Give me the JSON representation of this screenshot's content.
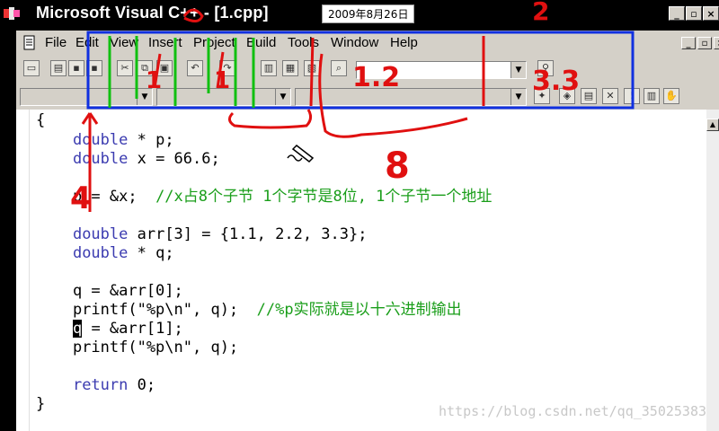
{
  "window": {
    "title": "Microsoft Visual C++ - [1.cpp]",
    "date_stamp": "2009年8月26日",
    "controls": [
      "_",
      "ꟷ",
      "×"
    ]
  },
  "menubar": {
    "items": [
      "File",
      "Edit",
      "View",
      "Insert",
      "Project",
      "Build",
      "Tools",
      "Window",
      "Help"
    ]
  },
  "toolbar": {
    "icons": [
      "new-file-icon",
      "open-folder-icon",
      "save-icon",
      "save-all-icon",
      "cut-icon",
      "copy-icon",
      "paste-icon",
      "undo-icon",
      "redo-icon",
      "workspace-icon",
      "output-icon",
      "window-list-icon",
      "find-in-files-icon"
    ],
    "find_combo_value": "",
    "wizard_icons": [
      "class-wizard-icon",
      "compile-icon",
      "build-icon",
      "stop-build-icon",
      "go-icon",
      "insert-breakpoint-icon",
      "hand-icon"
    ]
  },
  "code": {
    "lines": [
      "{",
      "    double * p;",
      "    double x = 66.6;",
      "",
      "    p = &x;  //x占8个子节 1个字节是8位, 1个子节一个地址",
      "",
      "    double arr[3] = {1.1, 2.2, 3.3};",
      "    double * q;",
      "",
      "    q = &arr[0];",
      "    printf(\"%p\\n\", q);  //%p实际就是以十六进制输出",
      "    q = &arr[1];",
      "    printf(\"%p\\n\", q);",
      "",
      "    return 0;",
      "}"
    ]
  },
  "annotations": {
    "labels": [
      "2",
      "1",
      "1",
      "1",
      "1.2",
      "3.3",
      "8",
      "4"
    ],
    "colors": {
      "red": "#e01010",
      "green": "#10c010",
      "blue": "#1030e0"
    }
  },
  "watermark": "https://blog.csdn.net/qq_35025383"
}
